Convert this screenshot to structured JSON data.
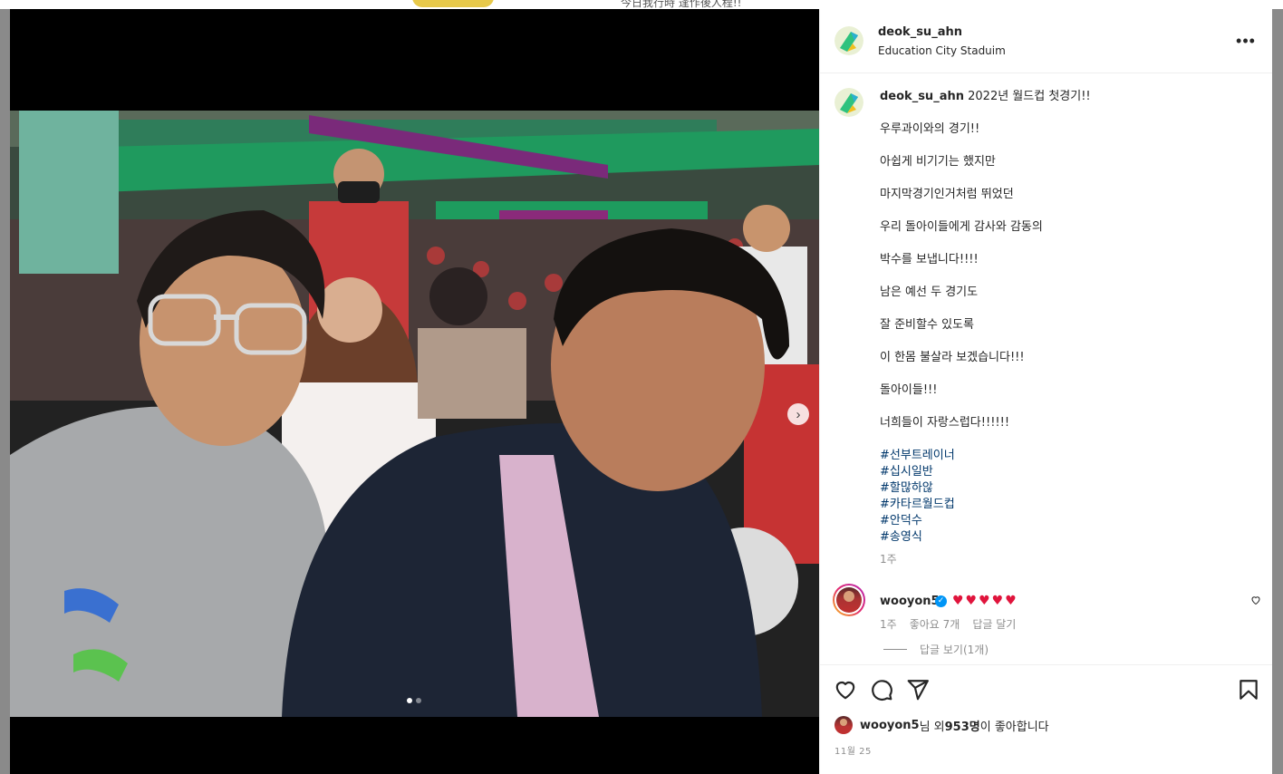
{
  "background": {
    "text": "今日我行時 逢作後人程!!"
  },
  "post": {
    "header": {
      "username": "deok_su_ahn",
      "location": "Education City Staduim",
      "more_icon": "more-horizontal-icon"
    },
    "caption": {
      "username": "deok_su_ahn",
      "first_line": "2022년 월드컵 첫경기!!",
      "lines": [
        "우루과이와의 경기!!",
        "아쉽게 비기기는 했지만",
        "마지막경기인거처럼 뛰었던",
        "우리 돌아이들에게 감사와 감동의",
        "박수를 보냅니다!!!!",
        "남은 예선 두 경기도",
        "잘 준비할수 있도록",
        "이 한몸 불살라 보겠습니다!!!",
        "돌아이들!!!",
        "너희들이 자랑스럽다!!!!!!"
      ],
      "hashtags": [
        "#선부트레이너",
        "#십시일반",
        "#할많하않",
        "#카타르월드컵",
        "#안덕수",
        "#송영식"
      ],
      "time": "1주"
    },
    "comment": {
      "username": "wooyon5",
      "verified": true,
      "text": "❤️❤️❤️❤️❤️",
      "hearts": "♥♥♥♥♥",
      "time": "1주",
      "likes": "좋아요 7개",
      "reply": "답글 달기",
      "view_replies": "답글 보기(1개)"
    },
    "actions": {
      "like_icon": "heart-outline-icon",
      "comment_icon": "comment-bubble-icon",
      "share_icon": "paper-plane-icon",
      "save_icon": "bookmark-icon"
    },
    "liked_by": {
      "user": "wooyon5",
      "suffix_1": "님 외 ",
      "count": "953명",
      "suffix_2": "이 좋아합니다"
    },
    "date": "11월 25"
  },
  "carousel": {
    "current": 1,
    "total": 2,
    "next_icon": "chevron-right-icon"
  },
  "colors": {
    "hashtag": "#00376b",
    "heart": "#e0143c",
    "verified": "#0095f6",
    "muted": "#8e8e8e"
  }
}
